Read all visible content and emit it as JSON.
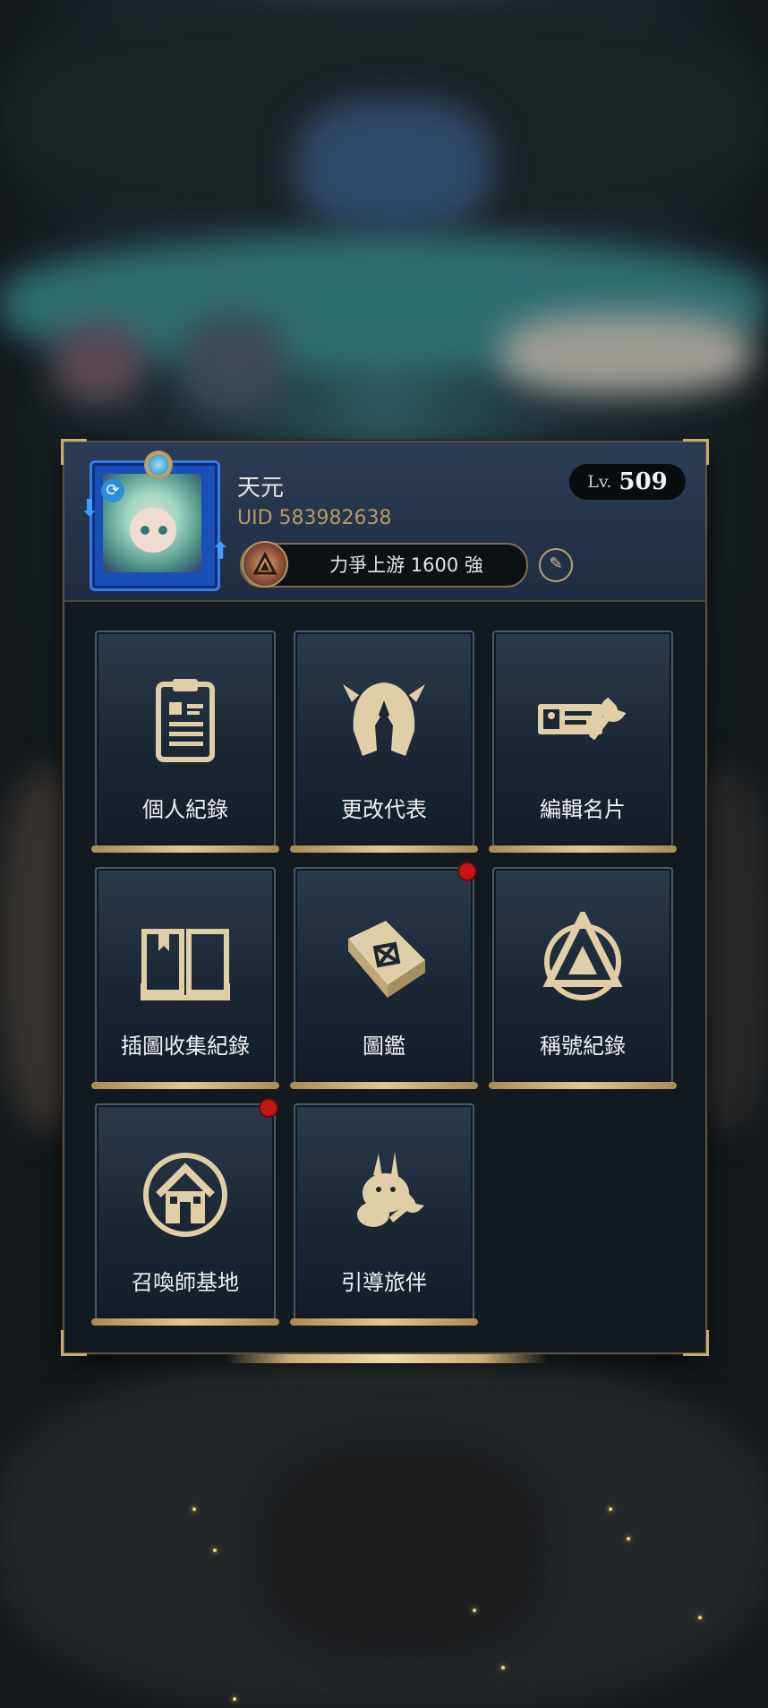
{
  "profile": {
    "name": "天元",
    "uid": "UID 583982638",
    "level_prefix": "Lv.",
    "level": "509",
    "title": "力爭上游 1600 強"
  },
  "menu": [
    {
      "label": "個人紀錄",
      "icon": "clipboard-icon",
      "notification": false
    },
    {
      "label": "更改代表",
      "icon": "helmet-icon",
      "notification": false
    },
    {
      "label": "編輯名片",
      "icon": "card-wrench-icon",
      "notification": false
    },
    {
      "label": "插圖收集紀錄",
      "icon": "open-book-icon",
      "notification": false
    },
    {
      "label": "圖鑑",
      "icon": "codex-book-icon",
      "notification": true
    },
    {
      "label": "稱號紀錄",
      "icon": "triangle-emblem-icon",
      "notification": false
    },
    {
      "label": "召喚師基地",
      "icon": "house-icon",
      "notification": true
    },
    {
      "label": "引導旅伴",
      "icon": "rabbit-wrench-icon",
      "notification": false
    }
  ],
  "colors": {
    "gold": "#c9ab72",
    "notification": "#c51515",
    "header": "#2b3d56"
  }
}
